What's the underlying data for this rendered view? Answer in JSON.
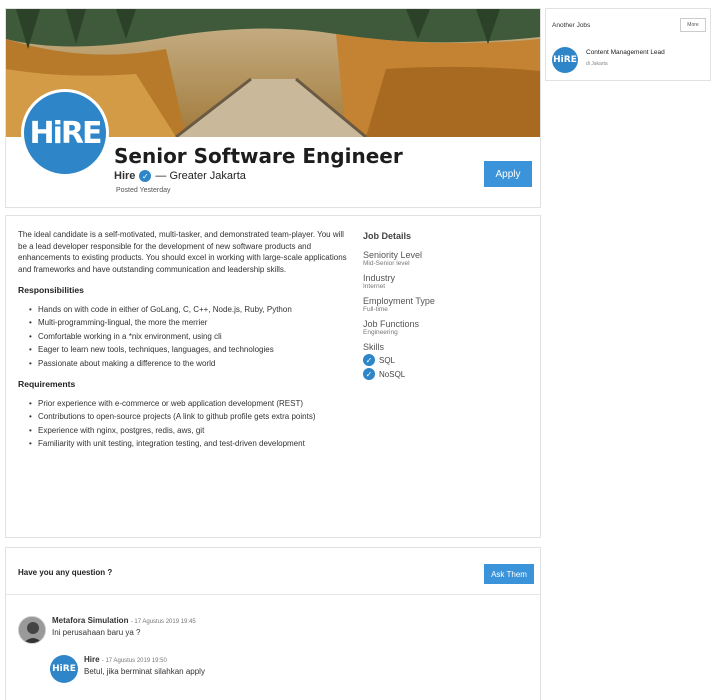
{
  "job": {
    "logo_text": "HiRE",
    "title": "Senior Software Engineer",
    "company": "Hire",
    "location": "— Greater Jakarta",
    "posted": "Posted Yesterday",
    "apply_label": "Apply"
  },
  "description": {
    "intro": "The ideal candidate is a self-motivated, multi-tasker, and demonstrated team-player. You will be a lead developer responsible for the development of new software products and enhancements to existing products. You should excel in working with large-scale applications and frameworks and have outstanding communication and leadership skills.",
    "responsibilities_heading": "Responsibilities",
    "responsibilities": [
      "Hands on with code in either of GoLang, C, C++, Node.js, Ruby, Python",
      "Multi-programming-lingual, the more the merrier",
      "Comfortable working in a *nix environment, using cli",
      "Eager to learn new tools, techniques, languages, and technologies",
      "Passionate about making a difference to the world"
    ],
    "requirements_heading": "Requirements",
    "requirements": [
      "Prior experience with e-commerce or web application development (REST)",
      "Contributions to open-source projects (A link to github profile gets extra points)",
      "Experience with nginx, postgres, redis, aws, git",
      "Familiarity with unit testing, integration testing, and test-driven development"
    ]
  },
  "job_details": {
    "heading": "Job Details",
    "seniority_label": "Seniority Level",
    "seniority_value": "Mid-Senior level",
    "industry_label": "Industry",
    "industry_value": "Internet",
    "employment_label": "Employment Type",
    "employment_value": "Full-time",
    "functions_label": "Job Functions",
    "functions_value": "Engineering",
    "skills_label": "Skills",
    "skills": [
      "SQL",
      "NoSQL"
    ]
  },
  "questions": {
    "heading": "Have you any question ?",
    "ask_label": "Ask Them",
    "comments": [
      {
        "author": "Metafora Simulation",
        "date": "- 17 Agustus 2019 19:45",
        "text": "Ini perusahaan baru ya ?",
        "avatar": "user"
      },
      {
        "author": "Hire",
        "date": "- 17 Agustus 2019 19:50",
        "text": "Betul, jika berminat silahkan apply",
        "avatar": "HiRE"
      }
    ]
  },
  "sidebar": {
    "title": "Another Jobs",
    "more_label": "More",
    "logo_text": "HiRE",
    "job_title": "Content Management Lead",
    "job_location": "di Jakarta"
  },
  "colors": {
    "accent": "#3b93d9",
    "logo_blue": "#2e86c9"
  }
}
